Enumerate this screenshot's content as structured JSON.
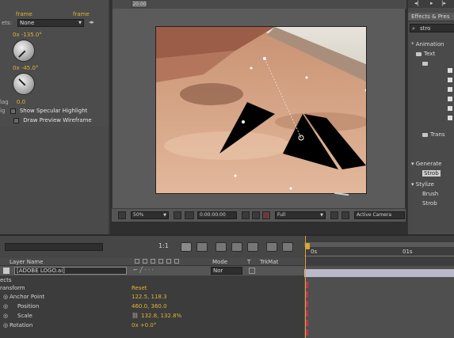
{
  "effect_controls": {
    "blend_label": "ets:",
    "blend_value": "None",
    "angle1_value": "0x -135.0°",
    "angle2_value": "0x -45.0°",
    "mag_label": "lag",
    "mag_value": "0.0",
    "specular_label": "Show Specular Highlight",
    "wireframe_label": "Draw Preview Wireframe",
    "partial_top1": "frame",
    "partial_top2": "frame"
  },
  "viewer": {
    "time_tab": "20:00",
    "zoom": "50%",
    "timecode": "0:00:00:00",
    "resolution": "Full",
    "active_camera": "Active Camera"
  },
  "effects_panel": {
    "title": "Effects & Pres",
    "search_value": "stro",
    "tree": {
      "animation": "* Animation",
      "text": "Text",
      "transitions": "Trans",
      "generate": "Generate",
      "generate_item": "Strob",
      "stylize": "Stylize",
      "stylize_item1": "Brush",
      "stylize_item2": "Strob"
    }
  },
  "timeline": {
    "col_layer_name": "Layer Name",
    "col_mode": "Mode",
    "col_t": "T",
    "col_trkmat": "TrkMat",
    "layer_name": "[ADOBE LOGO.ai]",
    "layer_mode": "Nor",
    "transform_label": "ransform",
    "transform_reset": "Reset",
    "section_label": "ects",
    "props": [
      {
        "name": "Anchor Point",
        "value": "122.5, 118.3"
      },
      {
        "name": "Position",
        "value": "460.0, 360.0"
      },
      {
        "name": "Scale",
        "value": "132.8, 132.8%"
      },
      {
        "name": "Rotation",
        "value": "0x +0.0°"
      }
    ],
    "ruler_marks": [
      "0s",
      "01s"
    ]
  },
  "colors": {
    "accent_yellow": "#e0b531",
    "timeline_marker": "#d9a63a",
    "keyframe_red": "#c8324a"
  }
}
